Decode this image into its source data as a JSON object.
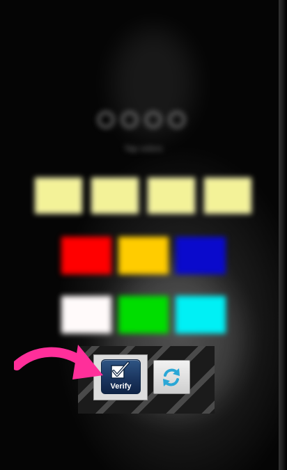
{
  "lock": {
    "prompt": "Tap colors",
    "pin_dots": 4,
    "slots": [
      "",
      "",
      "",
      ""
    ]
  },
  "color_buttons": {
    "row1": [
      {
        "name": "red",
        "color": "#ff0000"
      },
      {
        "name": "yellow",
        "color": "#ffcc00"
      },
      {
        "name": "blue",
        "color": "#0a0acc"
      }
    ],
    "row2": [
      {
        "name": "white",
        "color": "#fffafa"
      },
      {
        "name": "green",
        "color": "#00dd00"
      },
      {
        "name": "cyan",
        "color": "#00f0f5"
      }
    ]
  },
  "actions": {
    "verify_label": "Verify",
    "refresh_icon": "refresh-arrows-icon"
  },
  "annotation": {
    "arrow_color": "#ff2f9a",
    "arrow_icon": "curved-arrow-icon"
  }
}
